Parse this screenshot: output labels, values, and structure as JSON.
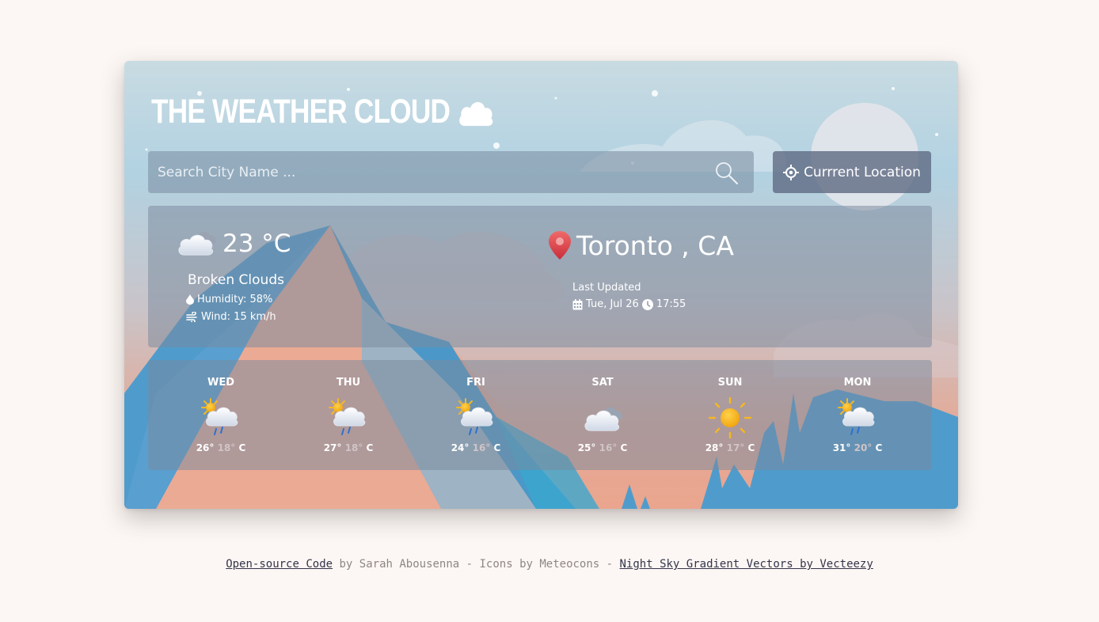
{
  "app": {
    "title": "THE WEATHER CLOUD"
  },
  "search": {
    "placeholder": "Search City Name ..."
  },
  "location_button": {
    "label": "Currrent Location"
  },
  "current": {
    "temperature": "23 °C",
    "description": "Broken Clouds",
    "humidity": "Humidity: 58%",
    "wind": "Wind: 15 km/h",
    "city": "Toronto , CA",
    "updated_label": "Last Updated",
    "date": "Tue, Jul 26",
    "time": "17:55"
  },
  "forecast": [
    {
      "day": "WED",
      "high": "26°",
      "low": "18°",
      "unit": "C",
      "icon": "sun-cloud-rain-icon"
    },
    {
      "day": "THU",
      "high": "27°",
      "low": "18°",
      "unit": "C",
      "icon": "sun-cloud-rain-icon"
    },
    {
      "day": "FRI",
      "high": "24°",
      "low": "16°",
      "unit": "C",
      "icon": "sun-cloud-rain-icon"
    },
    {
      "day": "SAT",
      "high": "25°",
      "low": "16°",
      "unit": "C",
      "icon": "broken-clouds-icon"
    },
    {
      "day": "SUN",
      "high": "28°",
      "low": "17°",
      "unit": "C",
      "icon": "sun-icon"
    },
    {
      "day": "MON",
      "high": "31°",
      "low": "20°",
      "unit": "C",
      "icon": "sun-cloud-rain-icon"
    }
  ],
  "footer": {
    "code_link": "Open-source Code",
    "by_text": " by Sarah Abousenna - Icons by Meteocons - ",
    "vectors_link": "Night Sky Gradient Vectors by Vecteezy"
  },
  "colors": {
    "page_bg": "#fcf7f4",
    "sky_top": "#c8dbe2",
    "sky_bottom": "#eaa58e",
    "mountain_blue": "#4e9ccb",
    "panel": "#7a8a9e",
    "button": "#5c6880",
    "pin_red": "#e0454a",
    "sun": "#f5b820"
  }
}
